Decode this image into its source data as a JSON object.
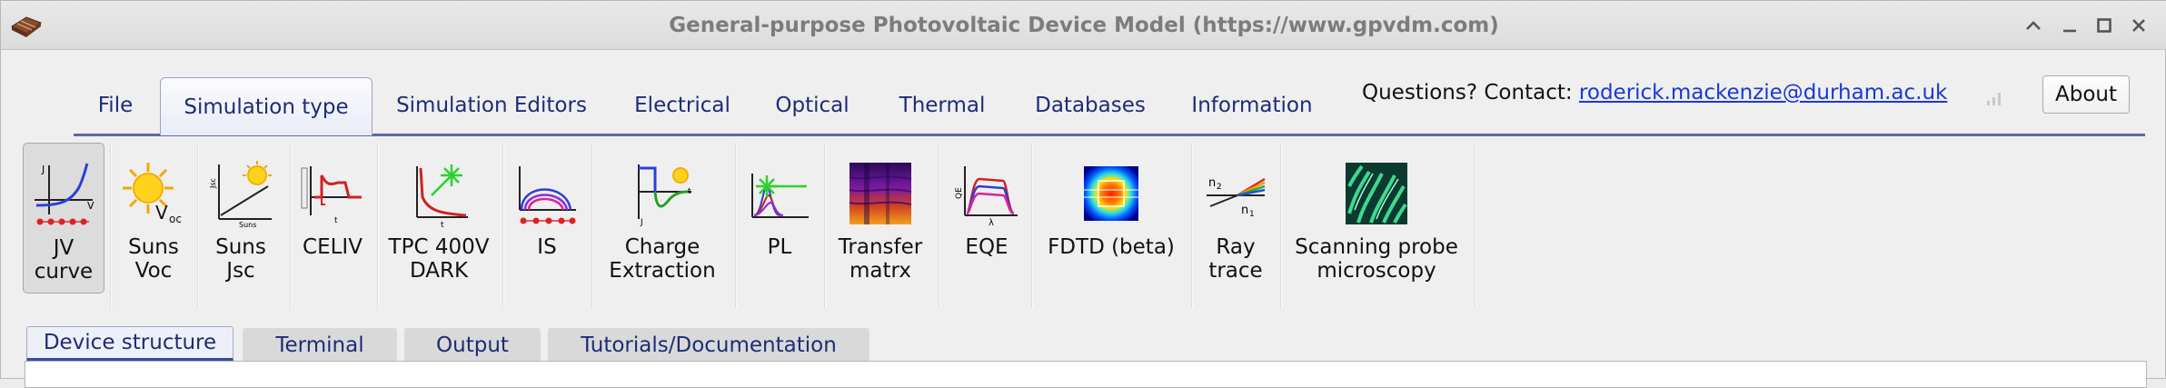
{
  "window": {
    "title": "General-purpose Photovoltaic Device Model (https://www.gpvdm.com)",
    "controls": [
      "chevron-up-icon",
      "minimize-icon",
      "maximize-icon",
      "close-icon"
    ]
  },
  "ribbon": {
    "tabs": [
      {
        "label": "File",
        "active": false
      },
      {
        "label": "Simulation type",
        "active": true
      },
      {
        "label": "Simulation Editors",
        "active": false
      },
      {
        "label": "Electrical",
        "active": false
      },
      {
        "label": "Optical",
        "active": false
      },
      {
        "label": "Thermal",
        "active": false
      },
      {
        "label": "Databases",
        "active": false
      },
      {
        "label": "Information",
        "active": false
      }
    ],
    "contact_prefix": "Questions? Contact: ",
    "contact_email": "roderick.mackenzie@durham.ac.uk",
    "about_label": "About"
  },
  "toolbar": {
    "items": [
      {
        "label": "JV\ncurve",
        "icon": "jv-curve-icon",
        "active": true
      },
      {
        "label": "Suns\nVoc",
        "icon": "suns-voc-icon",
        "active": false
      },
      {
        "label": "Suns\nJsc",
        "icon": "suns-jsc-icon",
        "active": false
      },
      {
        "label": "CELIV",
        "icon": "celiv-icon",
        "active": false
      },
      {
        "label": "TPC 400V\nDARK",
        "icon": "tpc-icon",
        "active": false
      },
      {
        "label": "IS",
        "icon": "impedance-icon",
        "active": false
      },
      {
        "label": "Charge\nExtraction",
        "icon": "charge-extraction-icon",
        "active": false
      },
      {
        "label": "PL",
        "icon": "pl-icon",
        "active": false
      },
      {
        "label": "Transfer\nmatrx",
        "icon": "transfer-matrix-icon",
        "active": false
      },
      {
        "label": "EQE",
        "icon": "eqe-icon",
        "active": false
      },
      {
        "label": "FDTD (beta)",
        "icon": "fdtd-icon",
        "active": false
      },
      {
        "label": "Ray\ntrace",
        "icon": "ray-trace-icon",
        "active": false
      },
      {
        "label": "Scanning probe\nmicroscopy",
        "icon": "spm-icon",
        "active": false
      }
    ],
    "icon_text": {
      "voc": "V",
      "voc_sub": "oc",
      "jsc_y": "Jsc",
      "jsc_x": "Suns",
      "n2": "n",
      "n2_sub": "2",
      "n1": "n",
      "n1_sub": "1",
      "eqe_y": "QE",
      "lambda": "λ",
      "t": "t",
      "j": "J",
      "v": "V"
    }
  },
  "subtabs": [
    {
      "label": "Device structure",
      "active": true
    },
    {
      "label": "Terminal",
      "active": false
    },
    {
      "label": "Output",
      "active": false
    },
    {
      "label": "Tutorials/Documentation",
      "active": false
    }
  ],
  "colors": {
    "tab_text": "#1e2c74",
    "accent_line": "#5d6aa5",
    "link": "#1a38d8"
  }
}
